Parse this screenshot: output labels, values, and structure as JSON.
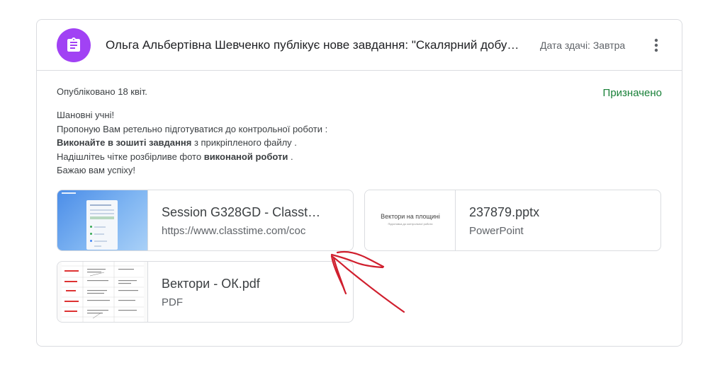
{
  "header": {
    "title": "Ольга Альбертівна Шевченко публікує нове завдання: \"Скалярний добу…",
    "due": "Дата здачі: Завтра",
    "icon": "assignment-icon",
    "icon_color": "#a142f4"
  },
  "meta": {
    "published": "Опубліковано 18 квіт.",
    "status": "Призначено",
    "status_color": "#188038"
  },
  "description": {
    "line1": "Шановні учні!",
    "line2": "Пропоную Вам ретельно підготуватися до контрольної роботи :",
    "line3_bold": "Виконайте в зошиті завдання",
    "line3_rest": " з прикріпленого файлу .",
    "line4_start": "Надішлітеь чітке розбірливе  фото ",
    "line4_bold": "виконаной роботи",
    "line4_end": " .",
    "line5": "Бажаю вам успіху!"
  },
  "attachments": [
    {
      "title": "Session G328GD - Classt…",
      "subtitle": "https://www.classtime.com/coc",
      "kind": "link"
    },
    {
      "title": "237879.pptx",
      "subtitle": "PowerPoint",
      "kind": "pptx",
      "thumb_title": "Вектори на площині",
      "thumb_subtitle": "Підготовка до контрольної роботи"
    },
    {
      "title": "Вектори - ОК.pdf",
      "subtitle": "PDF",
      "kind": "pdf"
    }
  ],
  "annotation": {
    "description": "red hand-drawn arrow",
    "color": "#d01f2e"
  }
}
